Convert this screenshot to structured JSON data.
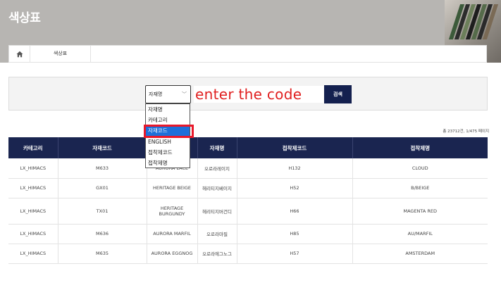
{
  "page_title": "색상표",
  "breadcrumb": {
    "current": "색상표"
  },
  "search": {
    "select_value": "자재명",
    "code_text": "enter the code",
    "button_label": "검색",
    "options": [
      "자재명",
      "카테고리",
      "자재코드",
      "ENGLISH",
      "접착제코드",
      "접착제명"
    ],
    "selected_option": "자재코드"
  },
  "count_text": "총 23712건, 1/475 페이지",
  "table": {
    "headers": [
      "카테고리",
      "자재코드",
      "",
      "자재명",
      "접착제코드",
      "접착제명"
    ],
    "rows": [
      [
        "LX_HIMACS",
        "M633",
        "AURORA LACE",
        "오로라레이지",
        "H132",
        "CLOUD"
      ],
      [
        "LX_HIMACS",
        "GX01",
        "HERITAGE BEIGE",
        "헤리티지베이지",
        "H52",
        "B/BEIGE"
      ],
      [
        "LX_HIMACS",
        "TX01",
        "HERITAGE BURGUNDY",
        "헤리티지버건디",
        "H66",
        "MAGENTA RED"
      ],
      [
        "LX_HIMACS",
        "M636",
        "AURORA MARFIL",
        "오로라마필",
        "H85",
        "AU/MARFIL"
      ],
      [
        "LX_HIMACS",
        "M635",
        "AURORA EGGNOG",
        "오로라에그노그",
        "H57",
        "AMSTERDAM"
      ]
    ]
  },
  "colors": {
    "header_navy": "#1a2550",
    "button_navy": "#14204f",
    "selected_blue": "#1e6fd9",
    "highlight_red": "#e8182a",
    "annotation_red": "#e02020"
  }
}
